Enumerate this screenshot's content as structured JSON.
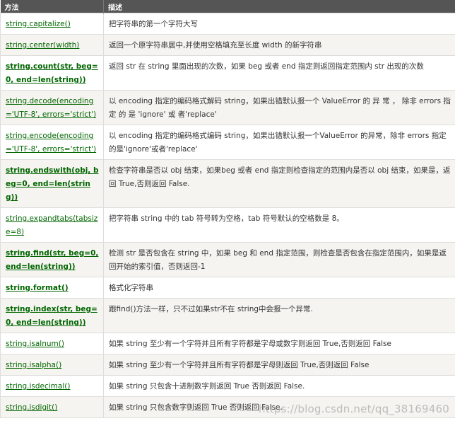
{
  "header": {
    "method": "方法",
    "description": "描述"
  },
  "rows": [
    {
      "method": "string.capitalize()",
      "bold": false,
      "description": "把字符串的第一个字符大写"
    },
    {
      "method": "string.center(width)",
      "bold": false,
      "description": "返回一个原字符串居中,并使用空格填充至长度 width 的新字符串"
    },
    {
      "method": "string.count(str, beg=0, end=len(string))",
      "bold": true,
      "description": "返回 str 在 string 里面出现的次数，如果 beg 或者 end 指定则返回指定范围内 str 出现的次数"
    },
    {
      "method": "string.decode(encoding='UTF-8', errors='strict')",
      "bold": false,
      "description": "以 encoding 指定的编码格式解码 string，如果出错默认报一个 ValueError 的 异 常 ， 除非 errors 指 定 的 是 'ignore' 或 者'replace'"
    },
    {
      "method": "string.encode(encoding='UTF-8', errors='strict')",
      "bold": false,
      "description": "以 encoding 指定的编码格式编码 string，如果出错默认报一个ValueError 的异常，除非 errors 指定的是'ignore'或者'replace'"
    },
    {
      "method": "string.endswith(obj, beg=0, end=len(string))",
      "bold": true,
      "description": "检查字符串是否以 obj 结束，如果beg 或者 end 指定则检查指定的范围内是否以 obj 结束，如果是，返回 True,否则返回 False."
    },
    {
      "method": "string.expandtabs(tabsize=8)",
      "bold": false,
      "description": "把字符串 string 中的 tab 符号转为空格，tab 符号默认的空格数是 8。"
    },
    {
      "method": "string.find(str, beg=0, end=len(string))",
      "bold": true,
      "description": "检测 str 是否包含在 string 中，如果 beg 和 end 指定范围，则检查是否包含在指定范围内，如果是返回开始的索引值，否则返回-1"
    },
    {
      "method": "string.format()",
      "bold": true,
      "description": "格式化字符串"
    },
    {
      "method": "string.index(str, beg=0, end=len(string))",
      "bold": true,
      "description": "跟find()方法一样，只不过如果str不在 string中会报一个异常."
    },
    {
      "method": "string.isalnum()",
      "bold": false,
      "description": "如果 string 至少有一个字符并且所有字符都是字母或数字则返回 True,否则返回 False"
    },
    {
      "method": "string.isalpha()",
      "bold": false,
      "description": "如果 string 至少有一个字符并且所有字符都是字母则返回 True,否则返回 False"
    },
    {
      "method": "string.isdecimal()",
      "bold": false,
      "description": "如果 string 只包含十进制数字则返回 True 否则返回 False."
    },
    {
      "method": "string.isdigit()",
      "bold": false,
      "description": "如果 string 只包含数字则返回 True 否则返回 False."
    }
  ],
  "watermark": "https://blog.csdn.net/qq_38169460"
}
